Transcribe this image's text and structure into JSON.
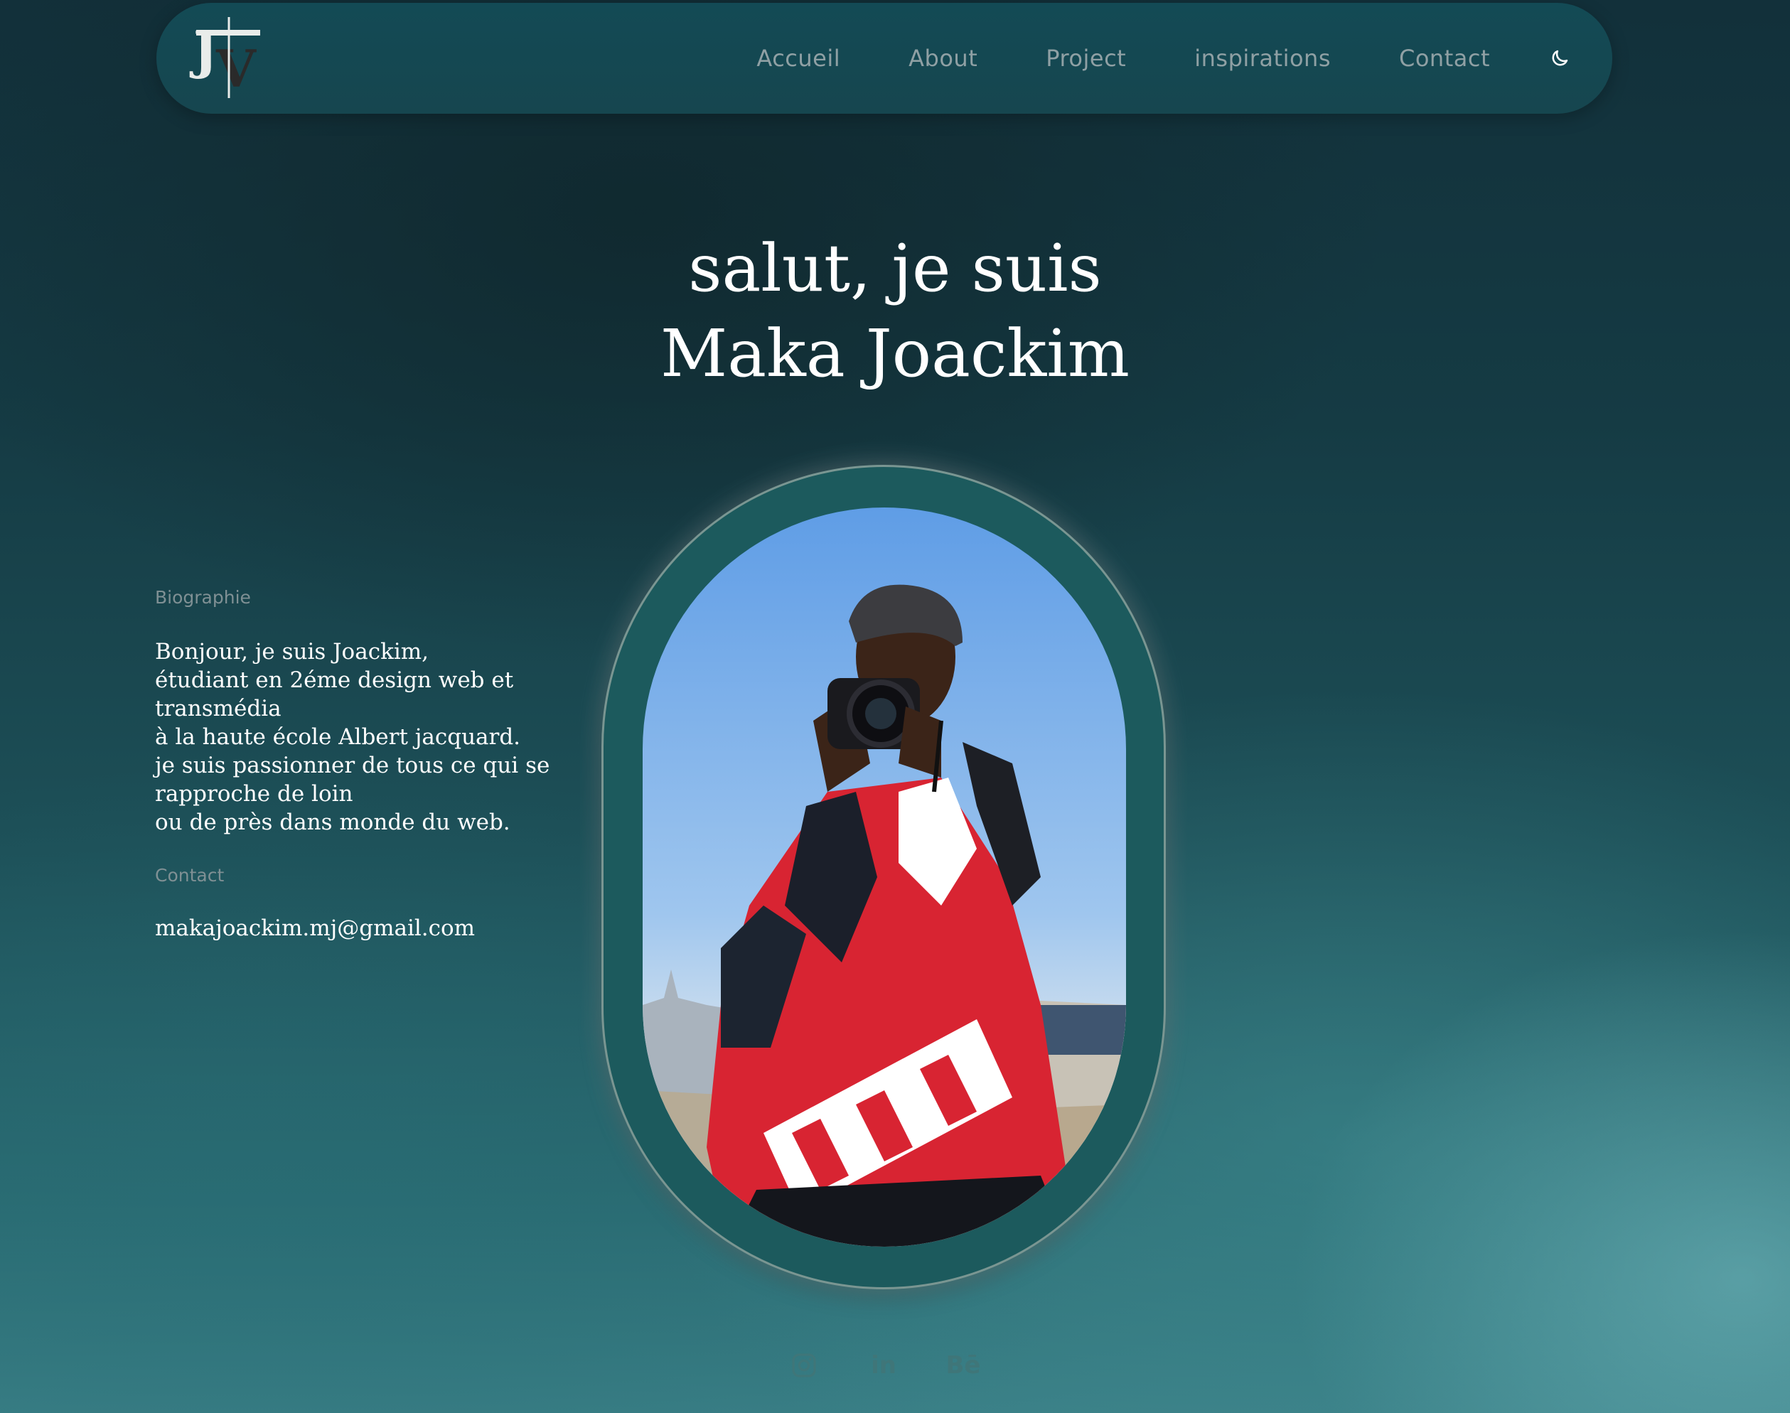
{
  "nav": {
    "logo_letters": "JV",
    "links": [
      {
        "label": "Accueil"
      },
      {
        "label": "About"
      },
      {
        "label": "Project"
      },
      {
        "label": "inspirations"
      },
      {
        "label": "Contact"
      }
    ],
    "theme_icon": "moon-icon"
  },
  "hero": {
    "line1": "salut, je suis",
    "line2": "Maka Joackim"
  },
  "info": {
    "bio_label": "Biographie",
    "bio_text": "Bonjour, je suis Joackim,\nétudiant en 2éme design web et transmédia\nà la haute école Albert jacquard.\nje suis passionner de tous ce qui se rapproche de loin\nou de près dans monde du web.",
    "contact_label": "Contact",
    "email": "makajoackim.mj@gmail.com"
  },
  "social": {
    "items": [
      {
        "icon": "instagram-icon"
      },
      {
        "icon": "linkedin-icon",
        "text": "in"
      },
      {
        "icon": "behance-icon",
        "text": "Bē"
      }
    ]
  },
  "colors": {
    "nav_bg": "#134a55",
    "nav_link": "#8fa0a4",
    "label": "#7f9094",
    "frame": "#1c5a5d",
    "social": "#3f7679"
  }
}
